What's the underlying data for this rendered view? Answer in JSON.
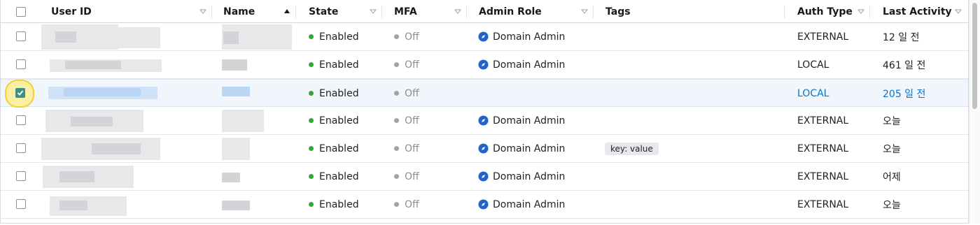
{
  "columns": {
    "user_id": "User ID",
    "name": "Name",
    "state": "State",
    "mfa": "MFA",
    "admin_role": "Admin Role",
    "tags": "Tags",
    "auth_type": "Auth Type",
    "last_activity": "Last Activity"
  },
  "sort": {
    "column": "name",
    "direction": "ascending"
  },
  "colors": {
    "enabled_dot": "#37a33a",
    "off_dot": "#a0a4a8",
    "link": "#0a73c8",
    "checkbox_checked": "#3f8f86",
    "highlight": "#f4cf2e"
  },
  "rows": [
    {
      "state": "Enabled",
      "mfa": "Off",
      "admin_role": "Domain Admin",
      "tag": "",
      "auth_type": "EXTERNAL",
      "last_activity": "12 일 전",
      "selected": false
    },
    {
      "state": "Enabled",
      "mfa": "Off",
      "admin_role": "Domain Admin",
      "tag": "",
      "auth_type": "LOCAL",
      "last_activity": "461 일 전",
      "selected": false
    },
    {
      "state": "Enabled",
      "mfa": "Off",
      "admin_role": "",
      "tag": "",
      "auth_type": "LOCAL",
      "last_activity": "205 일 전",
      "selected": true
    },
    {
      "state": "Enabled",
      "mfa": "Off",
      "admin_role": "Domain Admin",
      "tag": "",
      "auth_type": "EXTERNAL",
      "last_activity": "오늘",
      "selected": false
    },
    {
      "state": "Enabled",
      "mfa": "Off",
      "admin_role": "Domain Admin",
      "tag": "key: value",
      "auth_type": "EXTERNAL",
      "last_activity": "오늘",
      "selected": false
    },
    {
      "state": "Enabled",
      "mfa": "Off",
      "admin_role": "Domain Admin",
      "tag": "",
      "auth_type": "EXTERNAL",
      "last_activity": "어제",
      "selected": false
    },
    {
      "state": "Enabled",
      "mfa": "Off",
      "admin_role": "Domain Admin",
      "tag": "",
      "auth_type": "EXTERNAL",
      "last_activity": "오늘",
      "selected": false
    }
  ]
}
